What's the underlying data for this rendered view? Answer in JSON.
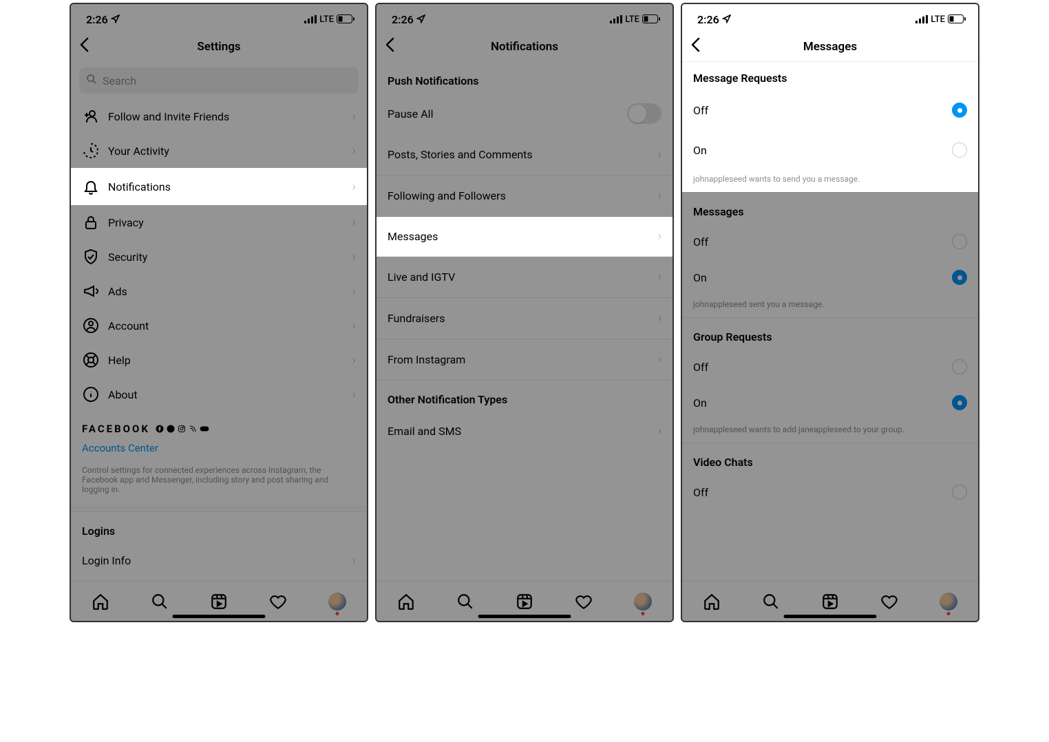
{
  "status": {
    "time": "2:26",
    "network": "LTE"
  },
  "screen1": {
    "title": "Settings",
    "search_placeholder": "Search",
    "items": {
      "follow_invite": "Follow and Invite Friends",
      "activity": "Your Activity",
      "notifications": "Notifications",
      "privacy": "Privacy",
      "security": "Security",
      "ads": "Ads",
      "account": "Account",
      "help": "Help",
      "about": "About"
    },
    "facebook_label": "FACEBOOK",
    "accounts_center": "Accounts Center",
    "accounts_center_desc": "Control settings for connected experiences across Instagram, the Facebook app and Messenger, including story and post sharing and logging in.",
    "logins_header": "Logins",
    "login_info": "Login Info"
  },
  "screen2": {
    "title": "Notifications",
    "push_header": "Push Notifications",
    "pause_all": "Pause All",
    "posts_stories": "Posts, Stories and Comments",
    "following_followers": "Following and Followers",
    "messages": "Messages",
    "live_igtv": "Live and IGTV",
    "fundraisers": "Fundraisers",
    "from_instagram": "From Instagram",
    "other_header": "Other Notification Types",
    "email_sms": "Email and SMS"
  },
  "screen3": {
    "title": "Messages",
    "sections": {
      "message_requests": {
        "header": "Message Requests",
        "off": "Off",
        "on": "On",
        "selected": "off",
        "footer": "johnappleseed wants to send you a message."
      },
      "messages": {
        "header": "Messages",
        "off": "Off",
        "on": "On",
        "selected": "on",
        "footer": "johnappleseed sent you a message."
      },
      "group_requests": {
        "header": "Group Requests",
        "off": "Off",
        "on": "On",
        "selected": "on",
        "footer": "johnappleseed wants to add janeappleseed to your group."
      },
      "video_chats": {
        "header": "Video Chats",
        "off": "Off"
      }
    }
  }
}
